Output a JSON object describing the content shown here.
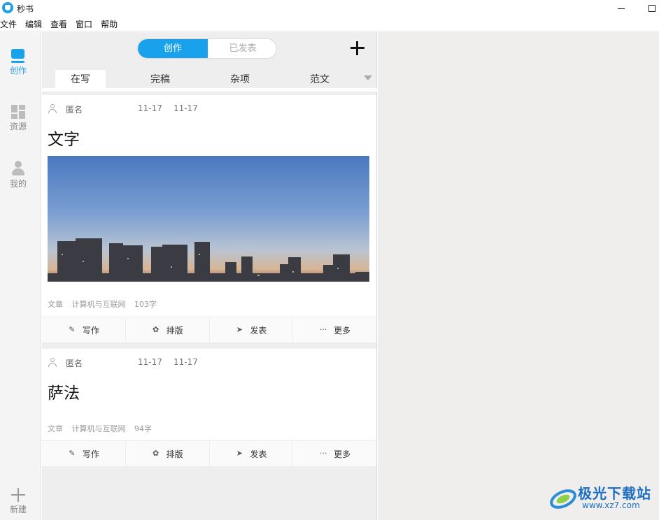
{
  "window": {
    "title": "秒书"
  },
  "menubar": {
    "items": [
      "文件",
      "编辑",
      "查看",
      "窗口",
      "帮助"
    ]
  },
  "sidebar": {
    "items": [
      {
        "label": "创作",
        "icon": "edit-icon",
        "active": true
      },
      {
        "label": "资源",
        "icon": "grid-icon",
        "active": false
      },
      {
        "label": "我的",
        "icon": "person-icon",
        "active": false
      }
    ],
    "new_label": "新建"
  },
  "list": {
    "toggle": {
      "create": "创作",
      "published": "已发表"
    },
    "subtabs": [
      "在写",
      "完稿",
      "杂项",
      "范文"
    ],
    "active_subtab": "在写"
  },
  "articles": [
    {
      "author": "匿名",
      "created": "11-17",
      "modified": "11-17",
      "title": "文字",
      "has_image": true,
      "type": "文章",
      "category": "计算机与互联网",
      "word_count": "103字"
    },
    {
      "author": "匿名",
      "created": "11-17",
      "modified": "11-17",
      "title": "萨法",
      "has_image": false,
      "type": "文章",
      "category": "计算机与互联网",
      "word_count": "94字"
    }
  ],
  "card_actions": {
    "write": "写作",
    "layout": "排版",
    "publish": "发表",
    "more": "更多"
  },
  "watermark": {
    "name": "极光下载站",
    "url": "www.xz7.com"
  },
  "colors": {
    "accent": "#1aa1ec",
    "sidebar_bg": "#f4f4f4",
    "list_bg": "#eeeeee",
    "right_bg": "#efeeed"
  }
}
